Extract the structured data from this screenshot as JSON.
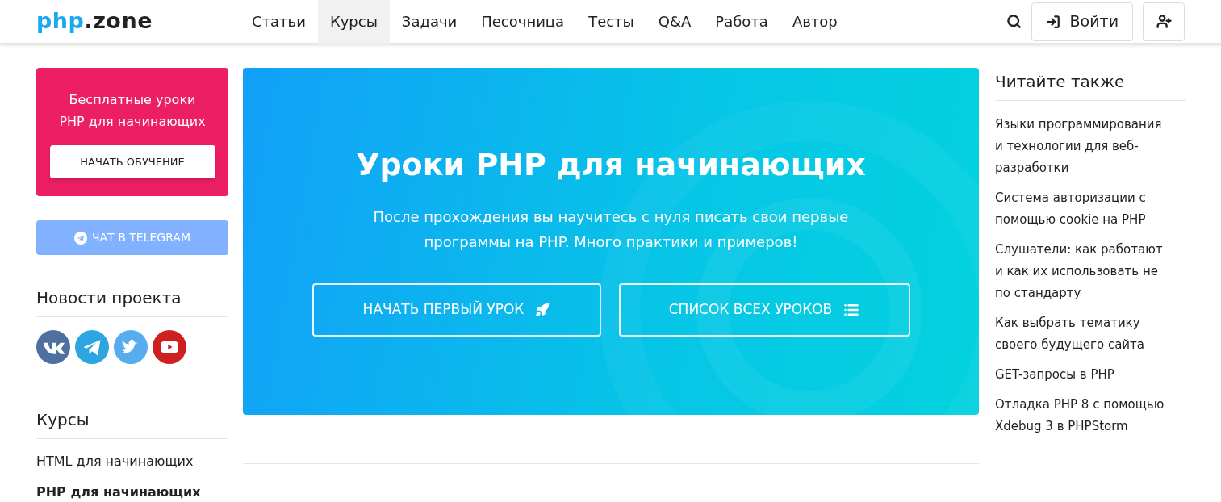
{
  "header": {
    "logo": {
      "accent": "php",
      "rest": ".zone"
    },
    "nav": [
      {
        "label": "Статьи",
        "selected": false
      },
      {
        "label": "Курсы",
        "selected": true
      },
      {
        "label": "Задачи",
        "selected": false
      },
      {
        "label": "Песочница",
        "selected": false
      },
      {
        "label": "Тесты",
        "selected": false
      },
      {
        "label": "Q&A",
        "selected": false
      },
      {
        "label": "Работа",
        "selected": false
      },
      {
        "label": "Автор",
        "selected": false
      }
    ],
    "login": "Войти"
  },
  "promo": {
    "title": "Бесплатные уроки PHP для начинающих",
    "button": "НАЧАТЬ ОБУЧЕНИЕ"
  },
  "telegram_button": "ЧАТ В TELEGRAM",
  "news": {
    "title": "Новости проекта",
    "social": [
      {
        "kind": "vk",
        "color": "#4f6f9f"
      },
      {
        "kind": "telegram",
        "color": "#2ca5e0"
      },
      {
        "kind": "twitter",
        "color": "#55acee"
      },
      {
        "kind": "youtube",
        "color": "#cd201f"
      }
    ]
  },
  "courses": {
    "title": "Курсы",
    "items": [
      {
        "label": "HTML для начинающих",
        "selected": false
      },
      {
        "label": "PHP для начинающих",
        "selected": true
      }
    ]
  },
  "hero": {
    "title": "Уроки PHP для начинающих",
    "text": "После прохождения вы научитесь с нуля писать свои первые программы на PHP. Много практики и примеров!",
    "buttons": [
      {
        "label": "НАЧАТЬ ПЕРВЫЙ УРОК",
        "kind": "rocket"
      },
      {
        "label": "СПИСОК ВСЕХ УРОКОВ",
        "kind": "list"
      }
    ]
  },
  "related": {
    "title": "Читайте также",
    "items": [
      "Языки программирования и технологии для веб-разработки",
      "Система авторизации с помощью cookie на PHP",
      "Слушатели: как работают и как их использовать не по стандарту",
      "Как выбрать тематику своего будущего сайта",
      "GET-запросы в PHP",
      "Отладка PHP 8 с помощью Xdebug 3 в PHPStorm"
    ]
  }
}
